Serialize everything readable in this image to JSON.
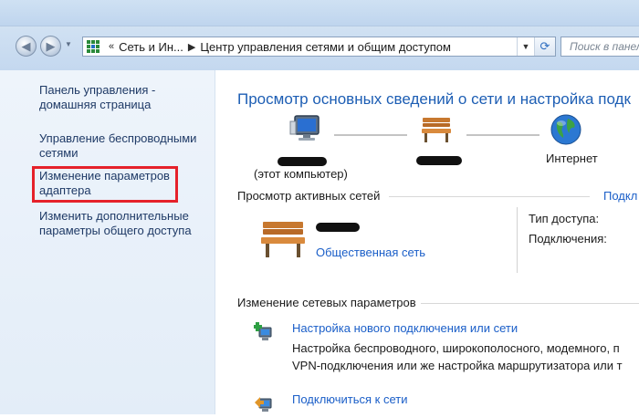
{
  "window": {
    "nav": {
      "back_icon": "back-arrow-icon",
      "forward_icon": "forward-arrow-icon"
    },
    "address_bar": {
      "crumbs": [
        "Сеть и Ин...",
        "Центр управления сетями и общим доступом"
      ],
      "overflow_marker": "«",
      "separator": "▶"
    },
    "search": {
      "placeholder": "Поиск в панели"
    }
  },
  "sidebar": {
    "items": [
      {
        "label": "Панель управления -\nдомашняя страница"
      },
      {
        "label": "Управление беспроводными\nсетями"
      },
      {
        "label": "Изменение параметров\nадаптера",
        "highlighted": true
      },
      {
        "label": "Изменить дополнительные\nпараметры общего доступа"
      }
    ],
    "highlight_color": "#e5212a"
  },
  "main": {
    "title": "Просмотр основных сведений о сети и настройка подк",
    "map": {
      "computer_label": "(этот компьютер)",
      "internet_label": "Интернет"
    },
    "active_networks": {
      "header": "Просмотр активных сетей",
      "header_link": "Подкл",
      "network_type": "Общественная сеть",
      "access_type_label": "Тип доступа:",
      "connections_label": "Подключения:"
    },
    "change_settings": {
      "header": "Изменение сетевых параметров",
      "tasks": [
        {
          "title": "Настройка нового подключения или сети",
          "desc_line1": "Настройка беспроводного, широкополосного, модемного, п",
          "desc_line2": "VPN-подключения или же настройка маршрутизатора или т"
        },
        {
          "title": "Подключиться к сети"
        }
      ]
    }
  },
  "colors": {
    "link": "#1a5ec8",
    "title": "#1d5eb4",
    "sidebar_link": "#1f3a66"
  }
}
